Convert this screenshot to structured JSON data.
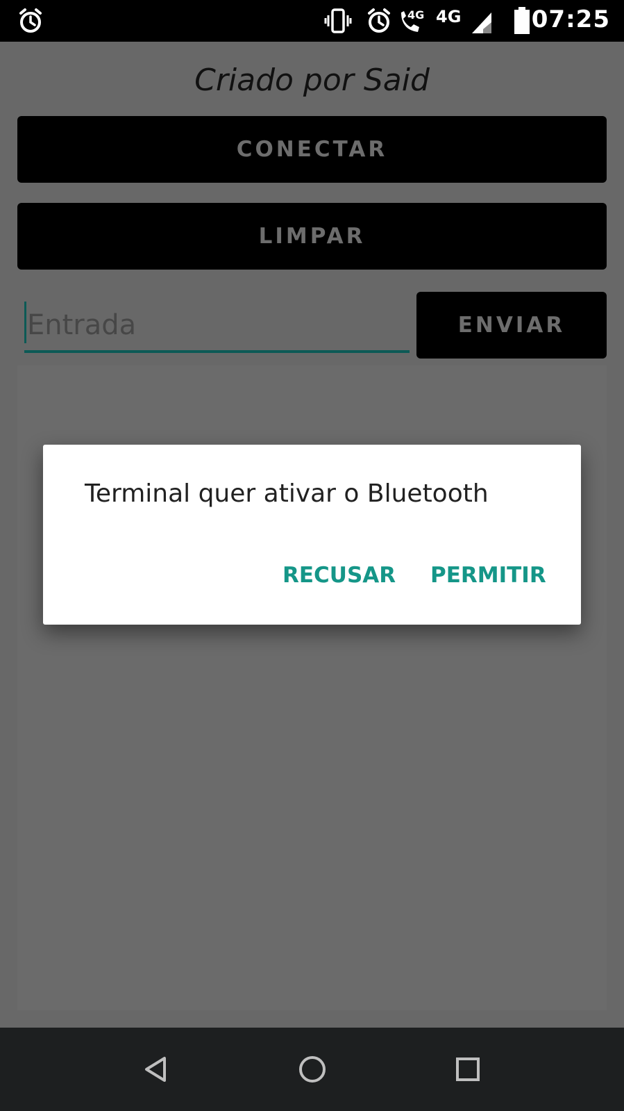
{
  "status_bar": {
    "time": "07:25",
    "network_small_label": "4G",
    "network_label": "4G",
    "icons": [
      "alarm-icon",
      "vibrate-icon",
      "alarm-icon",
      "volte-call-icon",
      "signal-icon",
      "battery-icon"
    ]
  },
  "app": {
    "title": "Criado por Said",
    "connect_label": "CONECTAR",
    "clear_label": "LIMPAR",
    "input_placeholder": "Entrada",
    "input_value": "",
    "send_label": "ENVIAR"
  },
  "dialog": {
    "message": "Terminal quer ativar o Bluetooth",
    "deny_label": "RECUSAR",
    "allow_label": "PERMITIR"
  },
  "navigation": {
    "buttons": [
      "back-icon",
      "home-icon",
      "recents-icon"
    ]
  },
  "colors": {
    "accent": "#159688",
    "input_underline": "#0c5a56",
    "scrim_background": "#686868",
    "button_background": "#000000"
  }
}
